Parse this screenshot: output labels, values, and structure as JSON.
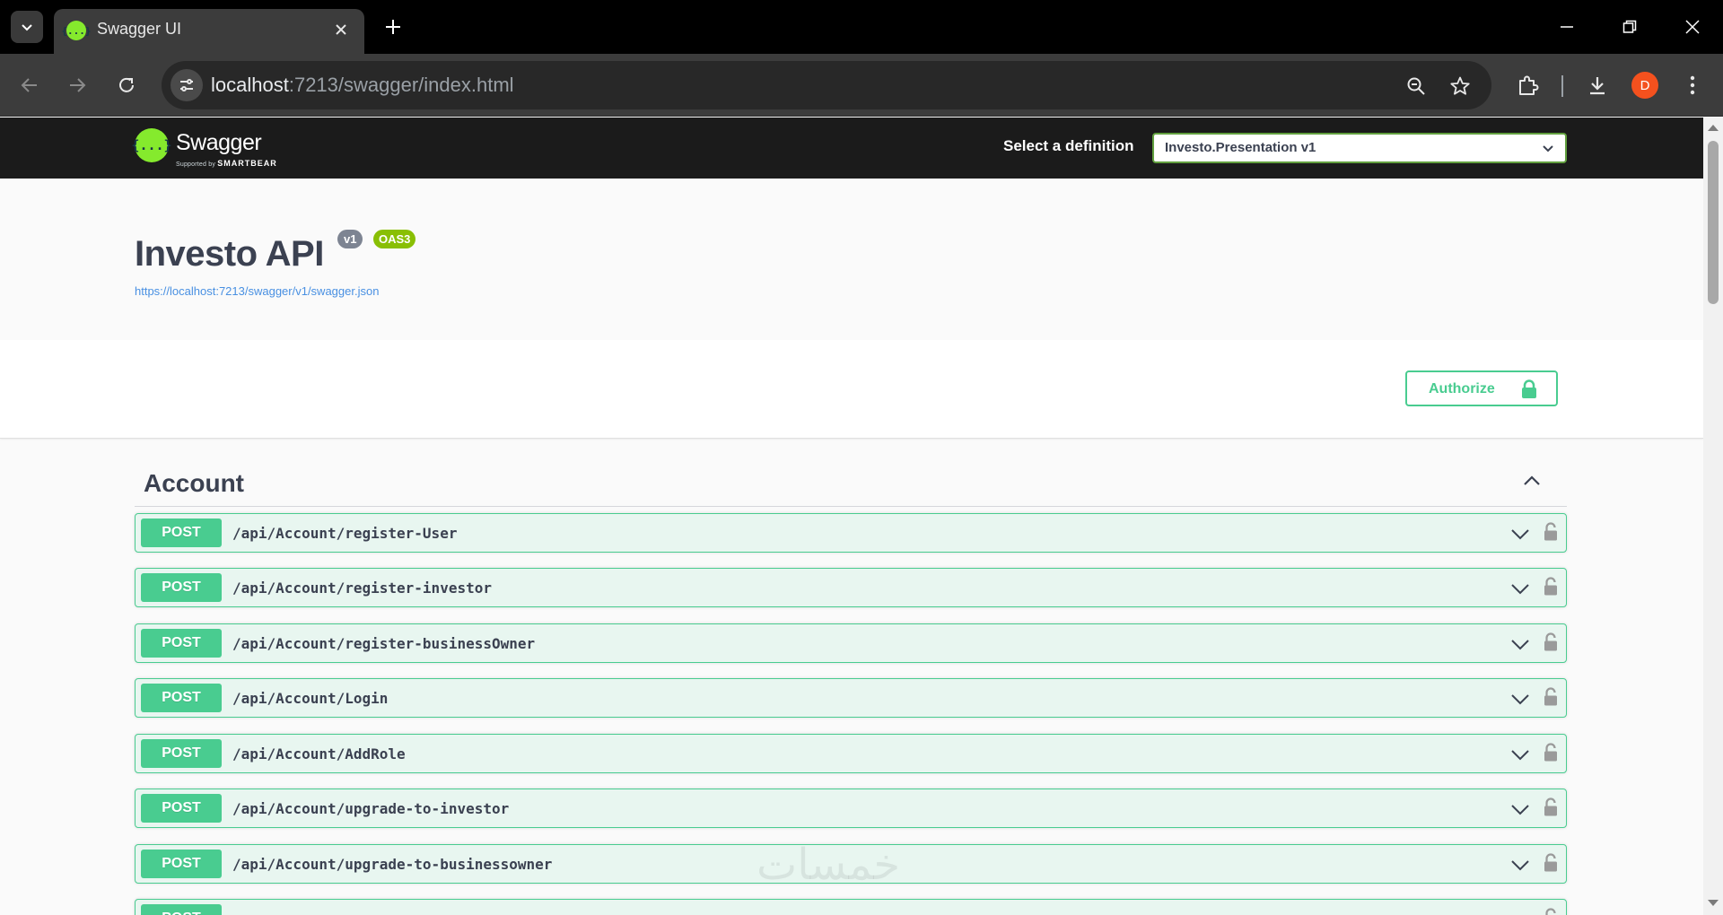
{
  "browser": {
    "tab_title": "Swagger UI",
    "tab_favicon_text": "{...}",
    "url_host": "localhost",
    "url_path": ":7213/swagger/index.html",
    "profile_initial": "D"
  },
  "swagger": {
    "logo_text": "{...}",
    "brand": "Swagger",
    "brand_sub_prefix": "Supported by",
    "brand_sub_company": "SMARTBEAR",
    "definition_label": "Select a definition",
    "definition_selected": "Investo.Presentation v1"
  },
  "info": {
    "title": "Investo API",
    "version_badge": "v1",
    "oas_badge": "OAS3",
    "spec_url": "https://localhost:7213/swagger/v1/swagger.json"
  },
  "authorize_label": "Authorize",
  "tag": {
    "name": "Account",
    "operations": [
      {
        "method": "POST",
        "path": "/api/Account/register-User"
      },
      {
        "method": "POST",
        "path": "/api/Account/register-investor"
      },
      {
        "method": "POST",
        "path": "/api/Account/register-businessOwner"
      },
      {
        "method": "POST",
        "path": "/api/Account/Login"
      },
      {
        "method": "POST",
        "path": "/api/Account/AddRole"
      },
      {
        "method": "POST",
        "path": "/api/Account/upgrade-to-investor"
      },
      {
        "method": "POST",
        "path": "/api/Account/upgrade-to-businessowner"
      },
      {
        "method": "POST",
        "path": ""
      }
    ]
  },
  "watermark": "خمسات",
  "colors": {
    "post_green": "#49cc90",
    "post_bg": "#e8f6f0",
    "swagger_green": "#85ea2d",
    "topbar": "#1b1b1b",
    "title_text": "#3b4151",
    "link_blue": "#4990e2"
  },
  "icons": {
    "tab_list": "chevron-down-icon",
    "tab_close": "close-icon",
    "new_tab": "plus-icon",
    "back": "arrow-left-icon",
    "forward": "arrow-right-icon",
    "reload": "reload-icon",
    "site_info": "tune-icon",
    "zoom": "zoom-icon",
    "bookmark": "star-icon",
    "extensions": "puzzle-icon",
    "downloads": "download-icon",
    "menu": "kebab-menu-icon",
    "authorize": "lock-icon",
    "operation_lock": "lock-icon",
    "expand": "chevron-down-icon",
    "collapse": "chevron-up-icon"
  }
}
